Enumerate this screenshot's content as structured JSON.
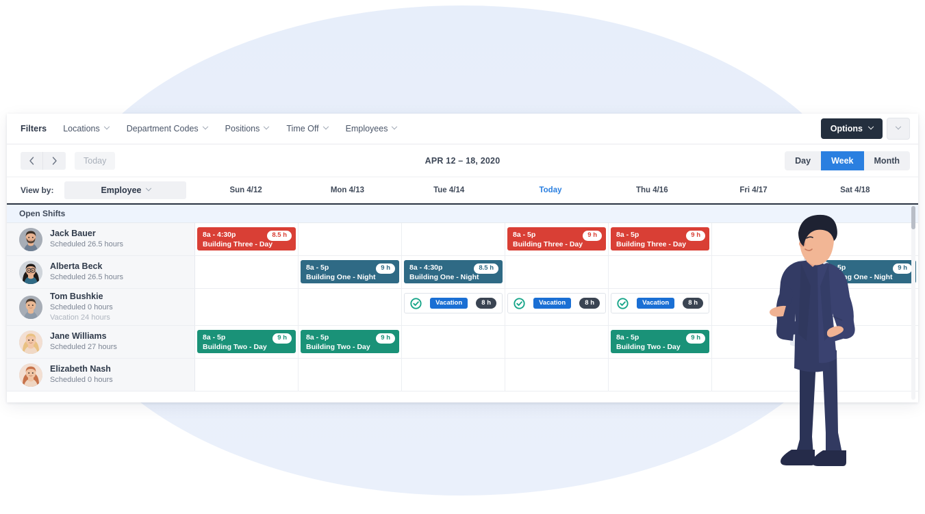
{
  "filter_bar": {
    "label": "Filters",
    "items": [
      {
        "label": "Locations",
        "icon": "chevron-down-icon"
      },
      {
        "label": "Department Codes",
        "icon": "chevron-down-icon"
      },
      {
        "label": "Positions",
        "icon": "chevron-down-icon"
      },
      {
        "label": "Time Off",
        "icon": "chevron-down-icon"
      },
      {
        "label": "Employees",
        "icon": "chevron-down-icon"
      }
    ],
    "options_label": "Options",
    "options_caret_icon": "chevron-down-icon"
  },
  "nav_bar": {
    "prev_icon": "chevron-left-icon",
    "next_icon": "chevron-right-icon",
    "today_label": "Today",
    "date_range": "APR 12 – 18, 2020",
    "views": [
      {
        "label": "Day",
        "active": false
      },
      {
        "label": "Week",
        "active": true
      },
      {
        "label": "Month",
        "active": false
      }
    ]
  },
  "view_by": {
    "label": "View by:",
    "value": "Employee",
    "caret_icon": "chevron-down-icon"
  },
  "days": [
    {
      "label": "Sun 4/12",
      "today": false
    },
    {
      "label": "Mon 4/13",
      "today": false
    },
    {
      "label": "Tue 4/14",
      "today": false
    },
    {
      "label": "Today",
      "today": true
    },
    {
      "label": "Thu 4/16",
      "today": false
    },
    {
      "label": "Fri 4/17",
      "today": false
    },
    {
      "label": "Sat 4/18",
      "today": false
    }
  ],
  "open_shifts_label": "Open Shifts",
  "rows": [
    {
      "name": "Jack Bauer",
      "sub1": "Scheduled 26.5 hours",
      "sub2": "",
      "avatar": "avatar-jack-bauer",
      "cells": [
        {
          "type": "shift",
          "color": "red",
          "time": "8a - 4:30p",
          "location": "Building Three - Day",
          "hours": "8.5 h"
        },
        {
          "type": "empty"
        },
        {
          "type": "empty"
        },
        {
          "type": "shift",
          "color": "red",
          "time": "8a - 5p",
          "location": "Building Three - Day",
          "hours": "9 h"
        },
        {
          "type": "shift",
          "color": "red",
          "time": "8a - 5p",
          "location": "Building Three - Day",
          "hours": "9 h"
        },
        {
          "type": "empty"
        },
        {
          "type": "empty"
        }
      ]
    },
    {
      "name": "Alberta Beck",
      "sub1": "Scheduled 26.5 hours",
      "sub2": "",
      "avatar": "avatar-alberta-beck",
      "cells": [
        {
          "type": "empty"
        },
        {
          "type": "shift",
          "color": "blue",
          "time": "8a - 5p",
          "location": "Building One - Night",
          "hours": "9 h"
        },
        {
          "type": "shift",
          "color": "blue",
          "time": "8a - 4:30p",
          "location": "Building One - Night",
          "hours": "8.5 h"
        },
        {
          "type": "empty"
        },
        {
          "type": "empty"
        },
        {
          "type": "empty"
        },
        {
          "type": "shift",
          "color": "blue",
          "time": "8a - 5p",
          "location": "Building One - Night",
          "hours": "9 h"
        }
      ]
    },
    {
      "name": "Tom Bushkie",
      "sub1": "Scheduled 0 hours",
      "sub2": "Vacation 24 hours",
      "avatar": "avatar-tom-bushkie",
      "cells": [
        {
          "type": "empty"
        },
        {
          "type": "empty"
        },
        {
          "type": "timeoff",
          "badge": "Vacation",
          "hours": "8 h",
          "icon": "approved-check-icon"
        },
        {
          "type": "timeoff",
          "badge": "Vacation",
          "hours": "8 h",
          "icon": "approved-check-icon"
        },
        {
          "type": "timeoff",
          "badge": "Vacation",
          "hours": "8 h",
          "icon": "approved-check-icon"
        },
        {
          "type": "empty"
        },
        {
          "type": "empty"
        }
      ]
    },
    {
      "name": "Jane Williams",
      "sub1": "Scheduled 27 hours",
      "sub2": "",
      "avatar": "avatar-jane-williams",
      "cells": [
        {
          "type": "shift",
          "color": "green",
          "time": "8a - 5p",
          "location": "Building Two - Day",
          "hours": "9 h"
        },
        {
          "type": "shift",
          "color": "green",
          "time": "8a - 5p",
          "location": "Building Two - Day",
          "hours": "9 h"
        },
        {
          "type": "empty"
        },
        {
          "type": "empty"
        },
        {
          "type": "shift",
          "color": "green",
          "time": "8a - 5p",
          "location": "Building Two - Day",
          "hours": "9 h"
        },
        {
          "type": "empty"
        },
        {
          "type": "empty"
        }
      ]
    },
    {
      "name": "Elizabeth Nash",
      "sub1": "Scheduled 0 hours",
      "sub2": "",
      "avatar": "avatar-elizabeth-nash",
      "cells": [
        {
          "type": "empty"
        },
        {
          "type": "empty"
        },
        {
          "type": "empty"
        },
        {
          "type": "empty"
        },
        {
          "type": "empty"
        },
        {
          "type": "empty"
        },
        {
          "type": "empty"
        }
      ]
    }
  ],
  "colors": {
    "accent_blue": "#2a7fe0",
    "shift_red": "#d93f35",
    "shift_blue": "#2f6a85",
    "shift_green": "#1a9278",
    "options_dark": "#242f3e",
    "vacation_badge": "#1a6fd4",
    "hours_dark": "#3a4452",
    "backdrop": "#e6edf9"
  }
}
